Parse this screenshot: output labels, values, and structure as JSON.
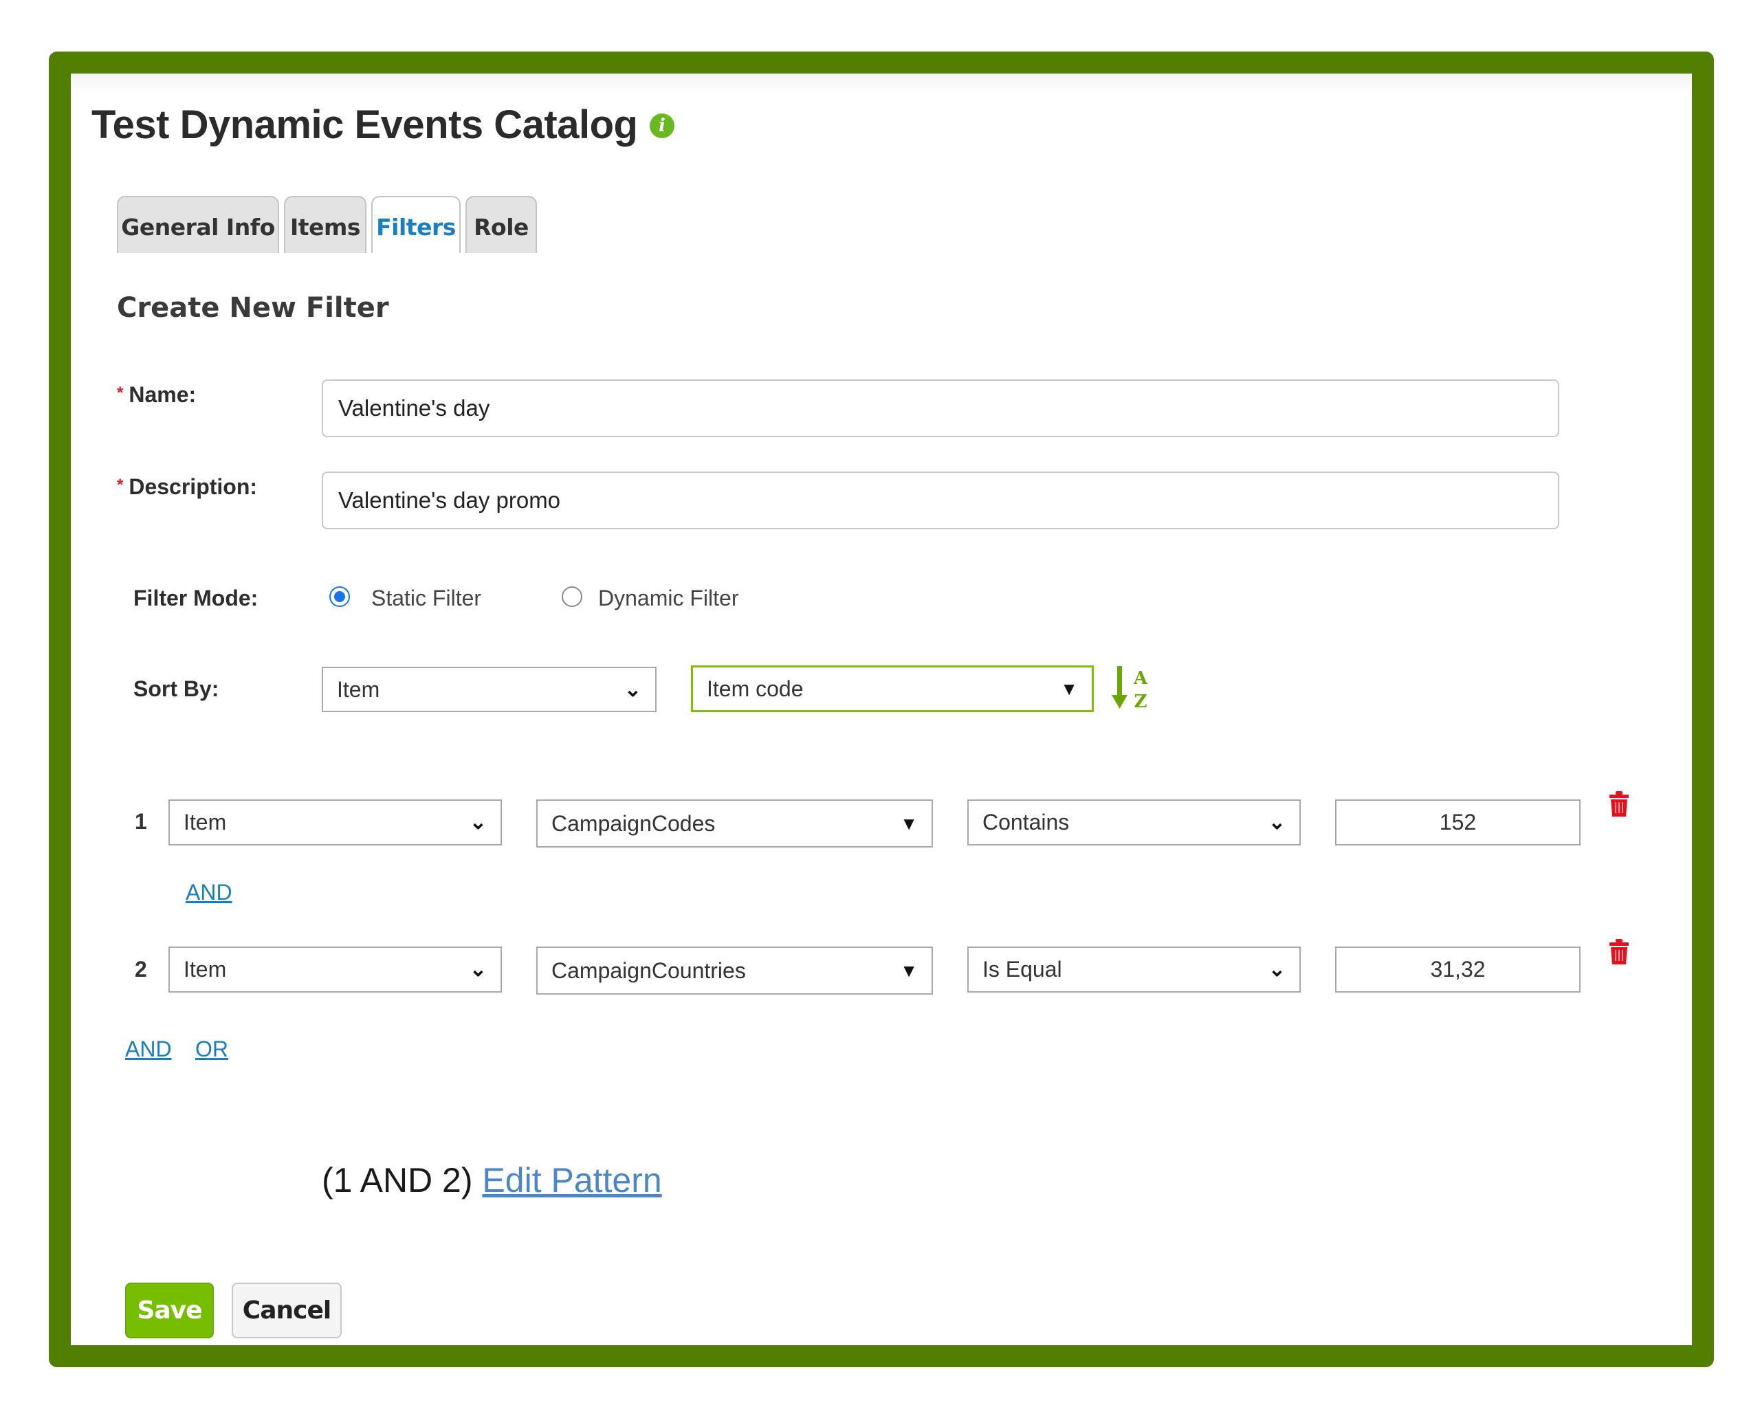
{
  "page": {
    "title": "Test Dynamic Events Catalog",
    "info_icon": "info-icon"
  },
  "tabs": [
    {
      "label": "General Info",
      "active": false
    },
    {
      "label": "Items",
      "active": false
    },
    {
      "label": "Filters",
      "active": true
    },
    {
      "label": "Role",
      "active": false
    }
  ],
  "form": {
    "section_title": "Create New Filter",
    "name": {
      "label": "Name:",
      "required_mark": "*",
      "value": "Valentine's day"
    },
    "description": {
      "label": "Description:",
      "required_mark": "*",
      "value": "Valentine's day promo"
    },
    "filter_mode": {
      "label": "Filter Mode:",
      "options": [
        {
          "label": "Static Filter",
          "checked": true
        },
        {
          "label": "Dynamic Filter",
          "checked": false
        }
      ]
    },
    "sort_by": {
      "label": "Sort By:",
      "entity": "Item",
      "field": "Item code",
      "sort_icon": "sort-alpha-asc-icon"
    }
  },
  "conditions": [
    {
      "number": "1",
      "entity": "Item",
      "field": "CampaignCodes",
      "operator": "Contains",
      "value": "152",
      "connector": "AND"
    },
    {
      "number": "2",
      "entity": "Item",
      "field": "CampaignCountries",
      "operator": "Is Equal",
      "value": "31,32"
    }
  ],
  "add_links": {
    "and": "AND",
    "or": "OR"
  },
  "pattern": {
    "text": "(1 AND 2)",
    "edit_link": "Edit Pattern"
  },
  "buttons": {
    "save": "Save",
    "cancel": "Cancel"
  },
  "icons": {
    "chevron": "❯",
    "triangle": "▼"
  },
  "colors": {
    "frame": "#537f00",
    "accent_green": "#77bd00",
    "link_blue": "#1a7fc0",
    "active_tab": "#1a7fc0",
    "delete_red": "#e8101e"
  }
}
